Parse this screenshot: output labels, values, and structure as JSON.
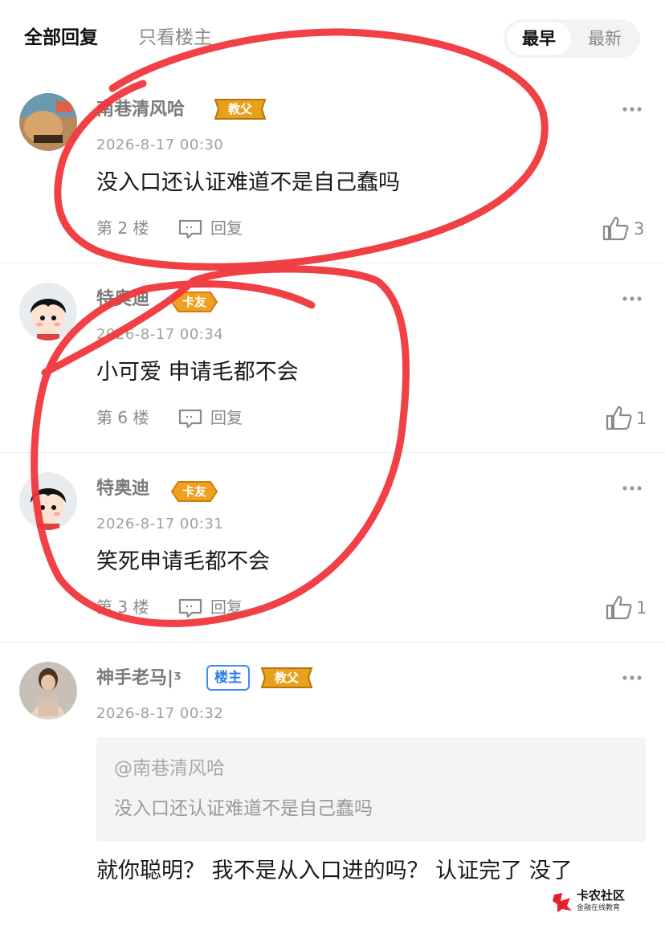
{
  "header": {
    "tab_all": "全部回复",
    "tab_op": "只看楼主",
    "sort_earliest": "最早",
    "sort_latest": "最新"
  },
  "comments": [
    {
      "username": "南巷清风哈",
      "badge": "教父",
      "time": "2026-8-17 00:30",
      "content": "没入口还认证难道不是自己蠢吗",
      "floor": "第 2 楼",
      "reply": "回复",
      "likes": "3"
    },
    {
      "username": "特奥迪",
      "badge": "卡友",
      "time": "2026-8-17 00:34",
      "content": "小可爱 申请毛都不会",
      "floor": "第 6 楼",
      "reply": "回复",
      "likes": "1"
    },
    {
      "username": "特奥迪",
      "badge": "卡友",
      "time": "2026-8-17 00:31",
      "content": "笑死申请毛都不会",
      "floor": "第 3 楼",
      "reply": "回复",
      "likes": "1"
    },
    {
      "username": "神手老马|ᶾ",
      "op_badge": "楼主",
      "badge": "教父",
      "time": "2026-8-17 00:32",
      "quote_user": "@南巷清风哈",
      "quote_text": "没入口还认证难道不是自己蠢吗",
      "content": "就你聪明？ 我不是从入口进的吗？ 认证完了 没了"
    }
  ],
  "watermark": {
    "title": "卡农社区",
    "subtitle": "金融在线教育"
  },
  "colors": {
    "badge_gold": "#e6a21a",
    "op_badge_blue": "#3d8cf0",
    "scribble_red": "#f0363c"
  }
}
